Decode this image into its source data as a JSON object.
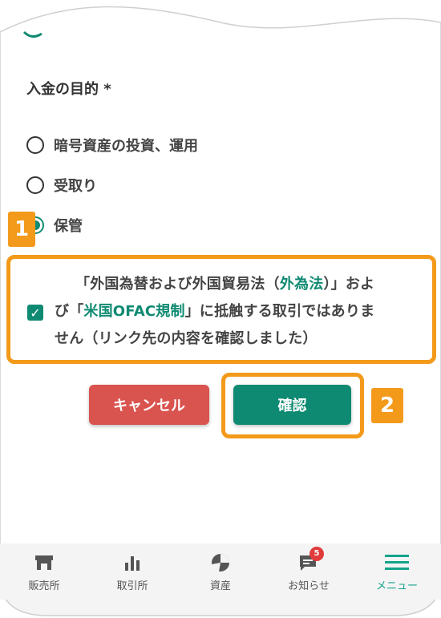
{
  "purpose": {
    "label": "入金の目的 *",
    "options": [
      {
        "label": "暗号資産の投資、運用",
        "selected": false
      },
      {
        "label": "受取り",
        "selected": false
      },
      {
        "label": "保管",
        "selected": true
      }
    ]
  },
  "consent": {
    "checked": true,
    "text_part1": "「外国為替および外国貿易法（",
    "link1": "外為法",
    "text_part2": "）」およ",
    "text_part3": "び「",
    "link2": "米国OFAC規制",
    "text_part4": "」に抵触する取引ではありま",
    "text_part5": "せん（リンク先の内容を確認しました）"
  },
  "buttons": {
    "cancel": "キャンセル",
    "confirm": "確認"
  },
  "annotations": {
    "badge1": "1",
    "badge2": "2"
  },
  "nav": {
    "items": [
      {
        "label": "販売所",
        "icon": "shop-icon"
      },
      {
        "label": "取引所",
        "icon": "bar-chart-icon"
      },
      {
        "label": "資産",
        "icon": "pie-icon"
      },
      {
        "label": "お知らせ",
        "icon": "message-icon",
        "badge": "5"
      },
      {
        "label": "メニュー",
        "icon": "hamburger-icon",
        "active": true
      }
    ]
  },
  "colors": {
    "accent": "#0f8a72",
    "cancel": "#d9534f",
    "callout": "#f39a1b",
    "nav_active": "#14a38b"
  }
}
